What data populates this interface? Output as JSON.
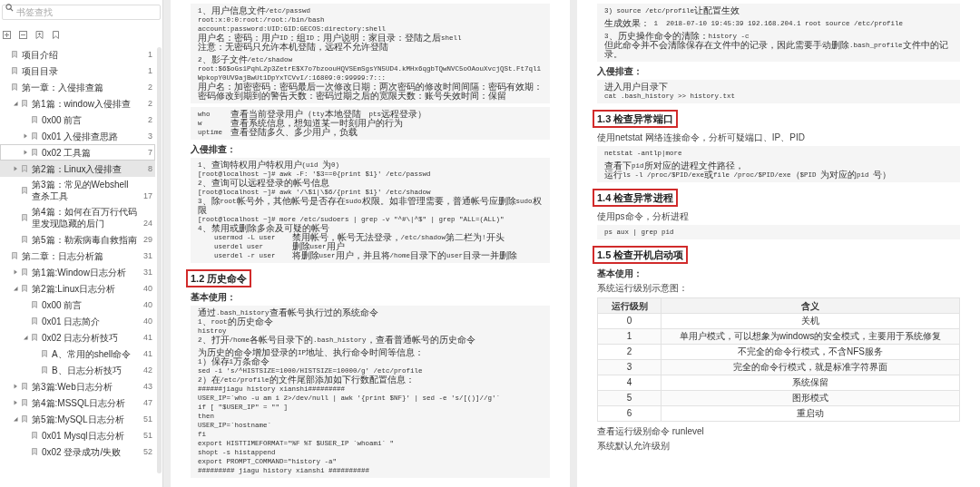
{
  "sidebar": {
    "search": {
      "placeholder": "书签查找"
    },
    "bookmarks": [
      {
        "label": "项目介绍",
        "page": "1",
        "selected": false,
        "hovered": false
      },
      {
        "label": "项目目录",
        "page": "1",
        "selected": false,
        "hovered": false
      },
      {
        "label": "第一章：入侵排查篇",
        "page": "2",
        "selected": false,
        "hovered": false,
        "children": [
          {
            "label": "第1篇：window入侵排查",
            "page": "2",
            "selected": false,
            "hovered": false,
            "expanded": true,
            "children": [
              {
                "label": "0x00 前言",
                "page": "2",
                "selected": false,
                "hovered": false
              },
              {
                "label": "0x01 入侵排查思路",
                "page": "3",
                "selected": false,
                "hovered": false,
                "expanded": false
              },
              {
                "label": "0x02 工具篇",
                "page": "7",
                "selected": false,
                "hovered": true,
                "expanded": false
              }
            ]
          },
          {
            "label": "第2篇：Linux入侵排查",
            "page": "8",
            "selected": true,
            "hovered": false,
            "expanded": false
          },
          {
            "label": "第3篇：常见的Webshell查杀工具",
            "page": "17",
            "selected": false,
            "hovered": false
          },
          {
            "label": "第4篇：如何在百万行代码里发现隐藏的后门",
            "page": "24",
            "selected": false,
            "hovered": false
          },
          {
            "label": "第5篇：勒索病毒自救指南",
            "page": "29",
            "selected": false,
            "hovered": false
          }
        ]
      },
      {
        "label": "第二章：日志分析篇",
        "page": "31",
        "selected": false,
        "hovered": false,
        "children": [
          {
            "label": "第1篇:Window日志分析",
            "page": "31",
            "selected": false,
            "hovered": false,
            "expanded": false
          },
          {
            "label": "第2篇:Linux日志分析",
            "page": "40",
            "selected": false,
            "hovered": false,
            "expanded": true,
            "children": [
              {
                "label": "0x00 前言",
                "page": "40",
                "selected": false,
                "hovered": false
              },
              {
                "label": "0x01 日志简介",
                "page": "40",
                "selected": false,
                "hovered": false
              },
              {
                "label": "0x02 日志分析技巧",
                "page": "41",
                "selected": false,
                "hovered": false,
                "expanded": true,
                "children": [
                  {
                    "label": "A、常用的shell命令",
                    "page": "41",
                    "selected": false,
                    "hovered": false
                  },
                  {
                    "label": "B、日志分析技巧",
                    "page": "42",
                    "selected": false,
                    "hovered": false
                  }
                ]
              }
            ]
          },
          {
            "label": "第3篇:Web日志分析",
            "page": "43",
            "selected": false,
            "hovered": false,
            "expanded": false
          },
          {
            "label": "第4篇:MSSQL日志分析",
            "page": "47",
            "selected": false,
            "hovered": false,
            "expanded": false
          },
          {
            "label": "第5篇:MySQL日志分析",
            "page": "51",
            "selected": false,
            "hovered": false,
            "expanded": true,
            "children": [
              {
                "label": "0x01 Mysql日志分析",
                "page": "51",
                "selected": false,
                "hovered": false
              },
              {
                "label": "0x02 登录成功/失败",
                "page": "52",
                "selected": false,
                "hovered": false
              }
            ]
          }
        ]
      }
    ]
  },
  "pages": [
    {
      "blocks": [
        {
          "kind": "code",
          "groups": [
            [
              "1、用户信息文件/etc/passwd",
              "root:x:0:0:root:/root:/bin/bash",
              "account:password:UID:GID:GECOS:directory:shell",
              "用户名：密码：用户ID：组ID：用户说明：家目录：登陆之后shell",
              "注意：无密码只允许本机登陆，远程不允许登陆"
            ],
            [
              "2、影子文件/etc/shadow",
              "root:$6$oGs1PqhL2p3ZetrE$X7o7bzoouHQVSEmSgsYN5UD4.kMHx6qgbTQwNVC5oOAouXvcjQSt.Ft7ql1WpkopY0UV9ajBwUt1DpYxTCVvI/:16809:0:99999:7:::",
              "用户名：加密密码：密码最后一次修改日期：两次密码的修改时间间隔：密码有效期：密码修改到期到的警告天数：密码过期之后的宽限天数：账号失效时间：保留"
            ]
          ]
        },
        {
          "kind": "code",
          "groups": [
            [
              "who     查看当前登录用户（tty本地登陆  pts远程登录）",
              "w       查看系统信息，想知道某一时刻用户的行为",
              "uptime  查看登陆多久、多少用户，负载"
            ]
          ]
        },
        {
          "kind": "label",
          "text": "入侵排查："
        },
        {
          "kind": "code",
          "groups": [
            [
              "1、查询特权用户特权用户(uid 为0)",
              "[root@localhost ~]# awk -F: '$3==0{print $1}' /etc/passwd",
              "2、查询可以远程登录的帐号信息",
              "[root@localhost ~]# awk '/\\$1|\\$6/{print $1}' /etc/shadow",
              "3、除root帐号外，其他帐号是否存在sudo权限。如非管理需要，普通帐号应删除sudo权限",
              "[root@localhost ~]# more /etc/sudoers | grep -v \"^#\\|^$\" | grep \"ALL=(ALL)\"",
              "4、禁用或删除多余及可疑的帐号",
              "    usermod -L user    禁用帐号，帐号无法登录，/etc/shadow第二栏为!开头",
              "    userdel user       删除user用户",
              "    userdel -r user    将删除user用户，并且将/home目录下的user目录一并删除"
            ]
          ]
        },
        {
          "kind": "heading",
          "text": "1.2 历史命令"
        },
        {
          "kind": "label",
          "text": "基本使用："
        },
        {
          "kind": "code",
          "groups": [
            [
              "通过.bash_history查看帐号执行过的系统命令",
              "1、root的历史命令",
              "histroy",
              "2、打开/home各帐号目录下的.bash_history，查看普通帐号的历史命令"
            ],
            [
              "为历史的命令增加登录的IP地址、执行命令时间等信息：",
              "1）保存1万条命令",
              "sed -i 's/^HISTSIZE=1000/HISTSIZE=10000/g' /etc/profile",
              "2）在/etc/profile的文件尾部添加如下行数配置信息：",
              "######jiagu history xianshi#########",
              "USER_IP=`who -u am i 2>/dev/null | awk '{print $NF}' | sed -e 's/[()]//g'`",
              "if [ \"$USER_IP\" = \"\" ]",
              "then",
              "USER_IP=`hostname`",
              "fi",
              "export HISTTIMEFORMAT=\"%F %T $USER_IP `whoami` \"",
              "shopt -s histappend",
              "export PROMPT_COMMAND=\"history -a\"",
              "######### jiagu history xianshi ##########"
            ]
          ]
        }
      ]
    },
    {
      "blocks": [
        {
          "kind": "code",
          "groups": [
            [
              "3) source /etc/profile让配置生效"
            ],
            [
              "生成效果： 1  2018-07-10 19:45:39 192.168.204.1 root source /etc/profile"
            ],
            [
              "3、历史操作命令的清除：history -c",
              "但此命令并不会清除保存在文件中的记录，因此需要手动删除.bash_profile文件中的记录。"
            ]
          ]
        },
        {
          "kind": "label",
          "text": "入侵排查："
        },
        {
          "kind": "code",
          "groups": [
            [
              "进入用户目录下",
              "cat .bash_history >> history.txt"
            ]
          ]
        },
        {
          "kind": "heading",
          "text": "1.3 检查异常端口"
        },
        {
          "kind": "paragraph",
          "text": "使用netstat 网络连接命令，分析可疑端口、IP、PID"
        },
        {
          "kind": "code",
          "groups": [
            [
              "netstat -antlp|more"
            ],
            [
              "查看下pid所对应的进程文件路径，",
              "运行ls -l /proc/$PID/exe或file /proc/$PID/exe（$PID 为对应的pid 号）"
            ]
          ]
        },
        {
          "kind": "heading",
          "text": "1.4 检查异常进程"
        },
        {
          "kind": "paragraph",
          "text": "使用ps命令，分析进程"
        },
        {
          "kind": "code",
          "groups": [
            [
              "ps aux | grep pid"
            ]
          ]
        },
        {
          "kind": "heading",
          "text": "1.5 检查开机启动项"
        },
        {
          "kind": "label",
          "text": "基本使用："
        },
        {
          "kind": "paragraph",
          "text": "系统运行级别示意图："
        },
        {
          "kind": "table",
          "columns": [
            "运行级别",
            "含义"
          ],
          "rows": [
            [
              "0",
              "关机"
            ],
            [
              "1",
              "单用户模式，可以想象为windows的安全模式，主要用于系统修复"
            ],
            [
              "2",
              "不完全的命令行模式，不含NFS服务"
            ],
            [
              "3",
              "完全的命令行模式，就是标准字符界面"
            ],
            [
              "4",
              "系统保留"
            ],
            [
              "5",
              "图形模式"
            ],
            [
              "6",
              "重启动"
            ]
          ]
        },
        {
          "kind": "paragraph",
          "text": "查看运行级别命令 runlevel"
        },
        {
          "kind": "paragraph",
          "text": "系统默认允许级别"
        }
      ]
    }
  ]
}
